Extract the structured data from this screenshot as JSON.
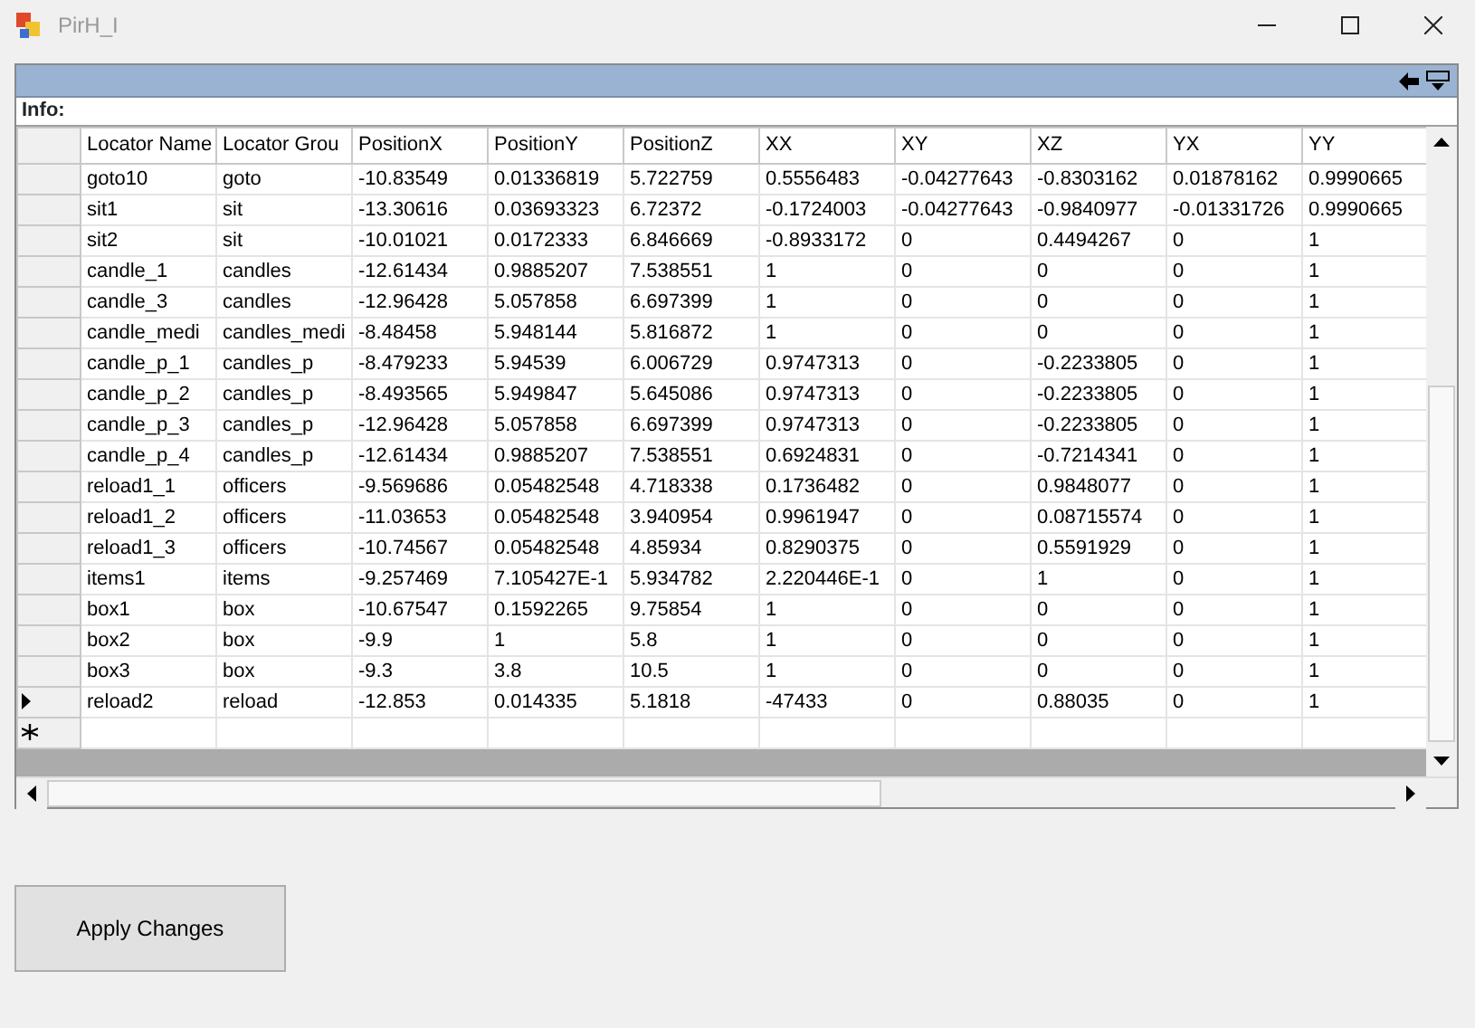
{
  "window": {
    "title": "PirH_I"
  },
  "panel": {
    "info_label": "Info:"
  },
  "table": {
    "columns": [
      "Locator Name",
      "Locator Grou",
      "PositionX",
      "PositionY",
      "PositionZ",
      "XX",
      "XY",
      "XZ",
      "YX",
      "YY"
    ],
    "rows": [
      {
        "current": false,
        "cells": [
          "goto10",
          "goto",
          "-10.83549",
          "0.01336819",
          "5.722759",
          "0.5556483",
          "-0.04277643",
          "-0.8303162",
          "0.01878162",
          "0.9990665"
        ]
      },
      {
        "current": false,
        "cells": [
          "sit1",
          "sit",
          "-13.30616",
          "0.03693323",
          "6.72372",
          "-0.1724003",
          "-0.04277643",
          "-0.9840977",
          "-0.01331726",
          "0.9990665"
        ]
      },
      {
        "current": false,
        "cells": [
          "sit2",
          "sit",
          "-10.01021",
          "0.0172333",
          "6.846669",
          "-0.8933172",
          "0",
          "0.4494267",
          "0",
          "1"
        ]
      },
      {
        "current": false,
        "cells": [
          "candle_1",
          "candles",
          "-12.61434",
          "0.9885207",
          "7.538551",
          "1",
          "0",
          "0",
          "0",
          "1"
        ]
      },
      {
        "current": false,
        "cells": [
          "candle_3",
          "candles",
          "-12.96428",
          "5.057858",
          "6.697399",
          "1",
          "0",
          "0",
          "0",
          "1"
        ]
      },
      {
        "current": false,
        "cells": [
          "candle_medi",
          "candles_medi",
          "-8.48458",
          "5.948144",
          "5.816872",
          "1",
          "0",
          "0",
          "0",
          "1"
        ]
      },
      {
        "current": false,
        "cells": [
          "candle_p_1",
          "candles_p",
          "-8.479233",
          "5.94539",
          "6.006729",
          "0.9747313",
          "0",
          "-0.2233805",
          "0",
          "1"
        ]
      },
      {
        "current": false,
        "cells": [
          "candle_p_2",
          "candles_p",
          "-8.493565",
          "5.949847",
          "5.645086",
          "0.9747313",
          "0",
          "-0.2233805",
          "0",
          "1"
        ]
      },
      {
        "current": false,
        "cells": [
          "candle_p_3",
          "candles_p",
          "-12.96428",
          "5.057858",
          "6.697399",
          "0.9747313",
          "0",
          "-0.2233805",
          "0",
          "1"
        ]
      },
      {
        "current": false,
        "cells": [
          "candle_p_4",
          "candles_p",
          "-12.61434",
          "0.9885207",
          "7.538551",
          "0.6924831",
          "0",
          "-0.7214341",
          "0",
          "1"
        ]
      },
      {
        "current": false,
        "cells": [
          "reload1_1",
          "officers",
          "-9.569686",
          "0.05482548",
          "4.718338",
          "0.1736482",
          "0",
          "0.9848077",
          "0",
          "1"
        ]
      },
      {
        "current": false,
        "cells": [
          "reload1_2",
          "officers",
          "-11.03653",
          "0.05482548",
          "3.940954",
          "0.9961947",
          "0",
          "0.08715574",
          "0",
          "1"
        ]
      },
      {
        "current": false,
        "cells": [
          "reload1_3",
          "officers",
          "-10.74567",
          "0.05482548",
          "4.85934",
          "0.8290375",
          "0",
          "0.5591929",
          "0",
          "1"
        ]
      },
      {
        "current": false,
        "cells": [
          "items1",
          "items",
          "-9.257469",
          "7.105427E-1",
          "5.934782",
          "2.220446E-1",
          "0",
          "1",
          "0",
          "1"
        ]
      },
      {
        "current": false,
        "cells": [
          "box1",
          "box",
          "-10.67547",
          "0.1592265",
          "9.75854",
          "1",
          "0",
          "0",
          "0",
          "1"
        ]
      },
      {
        "current": false,
        "cells": [
          "box2",
          "box",
          "-9.9",
          "1",
          "5.8",
          "1",
          "0",
          "0",
          "0",
          "1"
        ]
      },
      {
        "current": false,
        "cells": [
          "box3",
          "box",
          "-9.3",
          "3.8",
          "10.5",
          "1",
          "0",
          "0",
          "0",
          "1"
        ]
      },
      {
        "current": true,
        "cells": [
          "reload2",
          "reload",
          "-12.853",
          "0.014335",
          "5.1818",
          "-47433",
          "0",
          "0.88035",
          "0",
          "1"
        ]
      }
    ]
  },
  "buttons": [
    "Apply Changes"
  ]
}
